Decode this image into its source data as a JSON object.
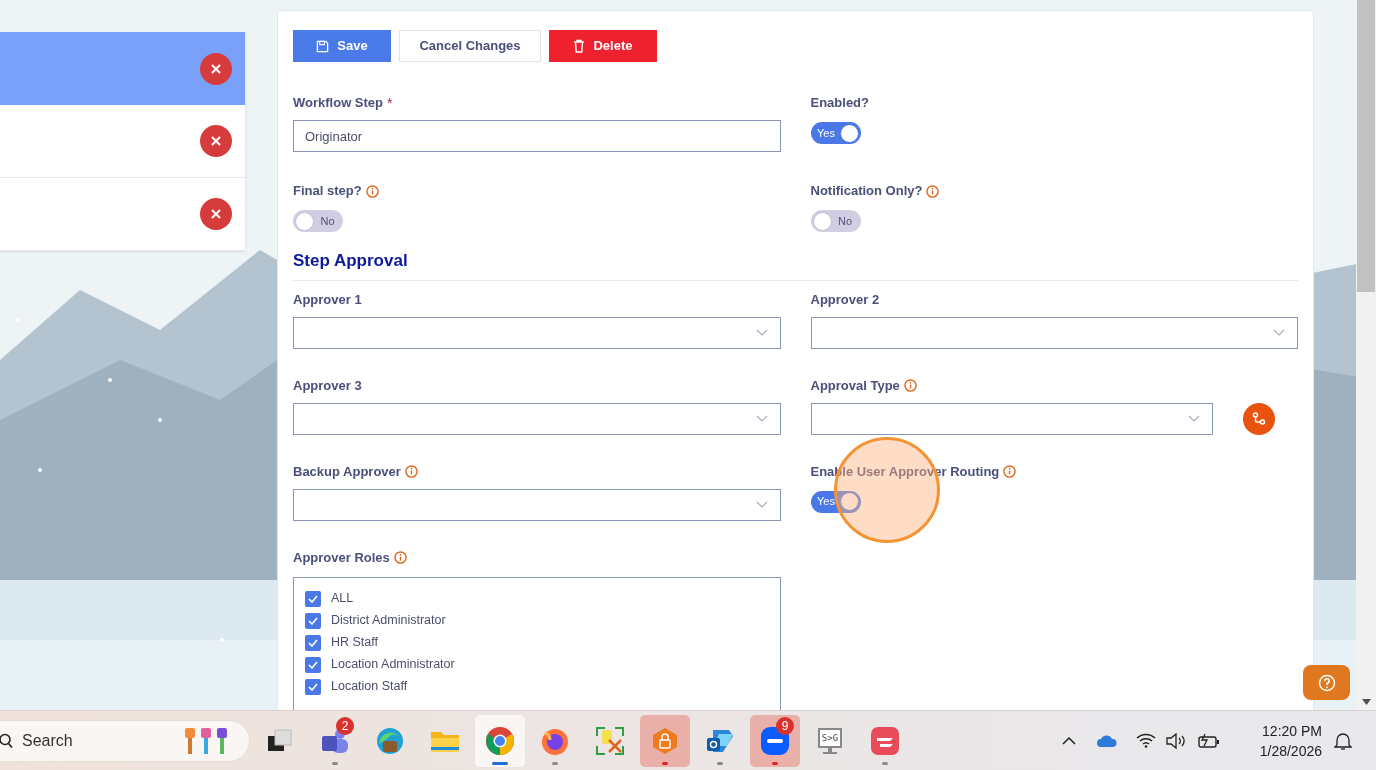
{
  "list_panel": {
    "items": [
      {
        "selected": true
      },
      {
        "selected": false
      },
      {
        "selected": false
      }
    ]
  },
  "toolbar": {
    "buttons": [
      {
        "label": "Save",
        "kind": "primary"
      },
      {
        "label": "Cancel Changes",
        "kind": "secondary"
      },
      {
        "label": "Delete",
        "kind": "danger"
      }
    ]
  },
  "sections": [
    {
      "rows": [
        [
          {
            "kind": "text",
            "label": "Workflow Step",
            "required_mark": "*",
            "info": false,
            "value": "Originator"
          },
          {
            "kind": "toggle",
            "label": "Enabled?",
            "info": false,
            "on": true,
            "text": "Yes"
          }
        ],
        [
          {
            "kind": "toggle",
            "label": "Final step?",
            "info": true,
            "on": false,
            "text": "No"
          },
          {
            "kind": "toggle",
            "label": "Notification Only?",
            "info": true,
            "on": false,
            "text": "No"
          }
        ]
      ]
    },
    {
      "title": "Step Approval",
      "rows": [
        [
          {
            "kind": "select",
            "label": "Approver 1",
            "info": false,
            "action": false
          },
          {
            "kind": "select",
            "label": "Approver 2",
            "info": false,
            "action": false
          }
        ],
        [
          {
            "kind": "select",
            "label": "Approver 3",
            "info": false,
            "action": false
          },
          {
            "kind": "select",
            "label": "Approval Type",
            "info": true,
            "action": true
          }
        ],
        [
          {
            "kind": "select",
            "label": "Backup Approver",
            "info": true,
            "action": false
          },
          {
            "kind": "toggle",
            "label": "Enable User Approver Routing",
            "info": true,
            "on": true,
            "text": "Yes"
          }
        ],
        [
          {
            "kind": "checklist",
            "label": "Approver Roles",
            "info": true,
            "options": [
              {
                "label": "ALL",
                "checked": true
              },
              {
                "label": "District Administrator",
                "checked": true
              },
              {
                "label": "HR Staff",
                "checked": true
              },
              {
                "label": "Location Administrator",
                "checked": true
              },
              {
                "label": "Location Staff",
                "checked": true
              }
            ]
          }
        ]
      ]
    }
  ],
  "taskbar": {
    "search": {
      "placeholder": "Search"
    },
    "apps": [
      {
        "kind": "taskview",
        "highlighted": false,
        "focused": false
      },
      {
        "kind": "teams",
        "highlighted": false,
        "focused": false,
        "color": "#8a8a8a",
        "badge": "2"
      },
      {
        "kind": "edge",
        "highlighted": false,
        "focused": false
      },
      {
        "kind": "files",
        "highlighted": false,
        "focused": false
      },
      {
        "kind": "chrome",
        "highlighted": true,
        "focused": true,
        "color": "#1f6fd6"
      },
      {
        "kind": "firefox",
        "highlighted": false,
        "focused": false,
        "color": "#8a8a8a"
      },
      {
        "kind": "tools",
        "highlighted": false,
        "focused": false
      },
      {
        "kind": "vpn",
        "highlighted": true,
        "focused": false,
        "color": "#d9262e"
      },
      {
        "kind": "outlook",
        "highlighted": false,
        "focused": false,
        "color": "#8a8a8a"
      },
      {
        "kind": "zoom",
        "highlighted": true,
        "focused": false,
        "color": "#d9262e",
        "badge": "9"
      },
      {
        "kind": "monitor",
        "highlighted": false,
        "focused": false,
        "text": "S>G"
      },
      {
        "kind": "flag",
        "highlighted": false,
        "focused": false,
        "color": "#8a8a8a"
      }
    ],
    "time": "12:20 PM",
    "date": "1/28/2026"
  }
}
